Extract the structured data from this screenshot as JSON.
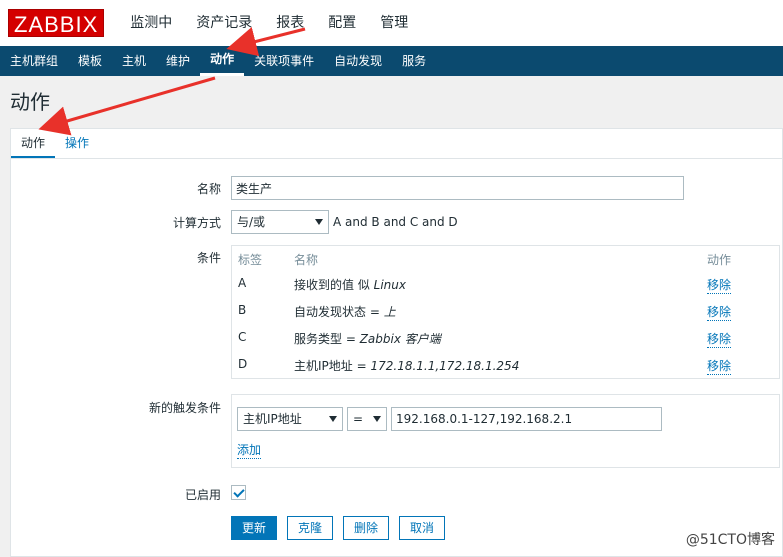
{
  "logo": "ZABBIX",
  "top_nav": [
    "监测中",
    "资产记录",
    "报表",
    "配置",
    "管理"
  ],
  "sub_nav": [
    "主机群组",
    "模板",
    "主机",
    "维护",
    "动作",
    "关联项事件",
    "自动发现",
    "服务"
  ],
  "page_title": "动作",
  "tabs": [
    "动作",
    "操作"
  ],
  "form": {
    "name_label": "名称",
    "name_value": "类生产",
    "calc_label": "计算方式",
    "calc_value": "与/或",
    "calc_formula": "A and B and C and D",
    "conditions_label": "条件",
    "conditions_headers": {
      "label": "标签",
      "name": "名称",
      "action": "动作"
    },
    "conditions": [
      {
        "label": "A",
        "name_prefix": "接收到的值 似 ",
        "name_value": "Linux",
        "action": "移除"
      },
      {
        "label": "B",
        "name_prefix": "自动发现状态 = ",
        "name_value": "上",
        "action": "移除"
      },
      {
        "label": "C",
        "name_prefix": "服务类型 = ",
        "name_value": "Zabbix 客户端",
        "action": "移除"
      },
      {
        "label": "D",
        "name_prefix": "主机IP地址 = ",
        "name_value": "172.18.1.1,172.18.1.254",
        "action": "移除"
      }
    ],
    "new_condition_label": "新的触发条件",
    "new_condition_type": "主机IP地址",
    "new_condition_operator": "=",
    "new_condition_value": "192.168.0.1-127,192.168.2.1",
    "add_label": "添加",
    "enabled_label": "已启用",
    "enabled": true
  },
  "buttons": {
    "update": "更新",
    "clone": "克隆",
    "delete": "删除",
    "cancel": "取消"
  },
  "watermark": "@51CTO博客",
  "colors": {
    "logo_bg": "#d40000",
    "subnav_bg": "#0b4a6f",
    "link": "#0275b8",
    "arrow": "#e8312a"
  }
}
